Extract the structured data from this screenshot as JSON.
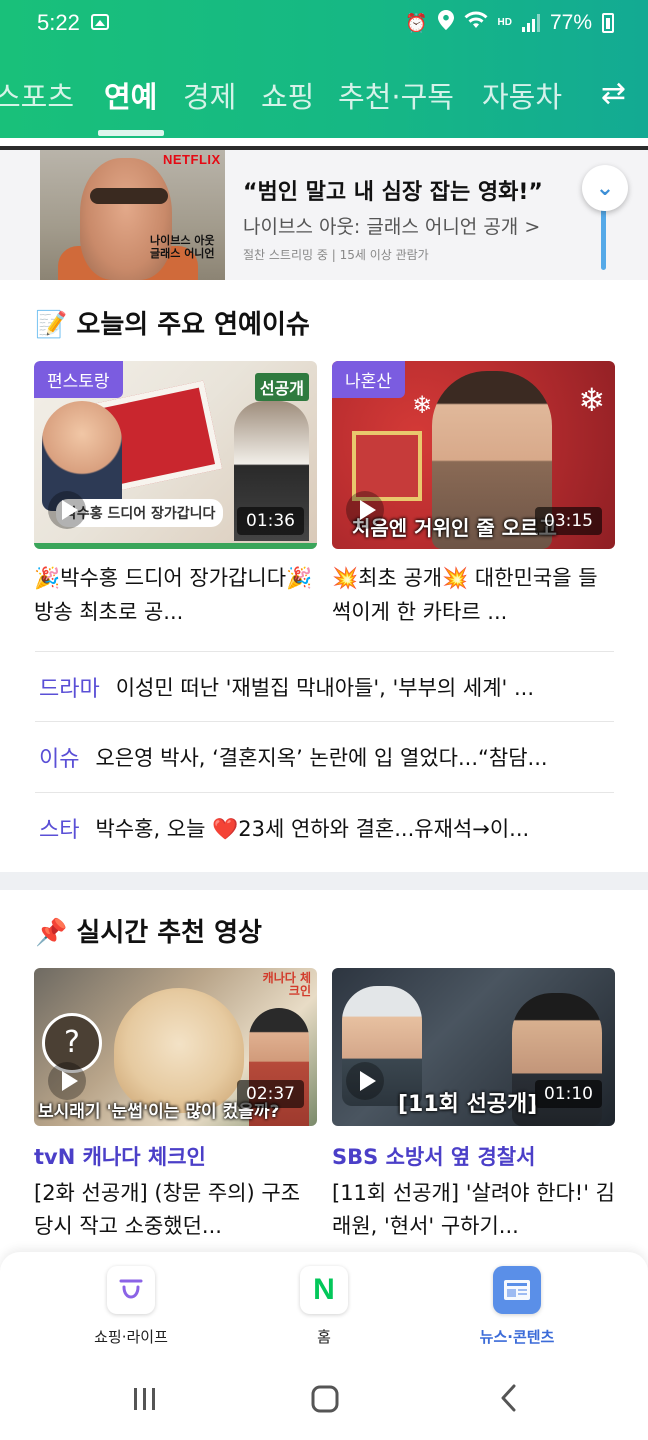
{
  "status_bar": {
    "time": "5:22",
    "battery": "77%",
    "hd_label": "HD"
  },
  "tabs": [
    {
      "label": "스포츠",
      "active": false
    },
    {
      "label": "연예",
      "active": true
    },
    {
      "label": "경제",
      "active": false
    },
    {
      "label": "쇼핑",
      "active": false
    },
    {
      "label": "추천·구독",
      "active": false
    },
    {
      "label": "자동차",
      "active": false
    }
  ],
  "banner": {
    "brand": "NETFLIX",
    "poster_title": "나이브스 아웃\n글래스 어니언",
    "headline": "“범인 말고 내 심장 잡는 영화!”",
    "subtitle": "나이브스 아웃: 글래스 어니언 공개 >",
    "meta": "절찬 스트리밍 중 | 15세 이상 관람가"
  },
  "issues_section": {
    "title": "📝 오늘의 주요 연예이슈",
    "cards": [
      {
        "badge": "편스토랑",
        "duration": "01:36",
        "title": "🎉박수홍 드디어 장가갑니다🎉 방송 최초로 공...",
        "thumb_caption": "박수홍 드디어 장가갑니다",
        "thumb_tag": "선공개"
      },
      {
        "badge": "나혼산",
        "duration": "03:15",
        "title": "💥최초 공개💥 대한민국을 들썩이게 한 카타르 ...",
        "thumb_caption": "처음엔 거위인 줄 오르고"
      }
    ],
    "rows": [
      {
        "category": "드라마",
        "text": "이성민 떠난 '재벌집 막내아들', '부부의 세계' ..."
      },
      {
        "category": "이슈",
        "text": "오은영 박사, ‘결혼지옥’ 논란에 입 열었다...“참담..."
      },
      {
        "category": "스타",
        "text": "박수홍, 오늘 ❤️23세 연하와 결혼...유재석→이..."
      }
    ]
  },
  "videos_section": {
    "title": "📌 실시간 추천 영상",
    "cards": [
      {
        "duration": "02:37",
        "channel": "tvN 캐나다 체크인",
        "description": "[2화 선공개] (창문 주의) 구조 당시 작고 소중했던...",
        "thumb_caption": "보시래기 '눈썹'이는 많이 컸을까?",
        "thumb_tag": "캐나다 체크인"
      },
      {
        "duration": "01:10",
        "channel": "SBS 소방서 옆 경찰서",
        "description": "[11회 선공개] '살려야 한다!' 김래원, '현서' 구하기...",
        "thumb_caption": "[11회 선공개]"
      }
    ]
  },
  "bottom_nav": [
    {
      "label": "쇼핑·라이프",
      "icon": "shopping-icon",
      "active": false
    },
    {
      "label": "홈",
      "icon": "naver-n-icon",
      "active": false,
      "glyph": "N"
    },
    {
      "label": "뉴스·콘텐츠",
      "icon": "news-icon",
      "active": true
    }
  ],
  "colors": {
    "header": "#17b886",
    "accent_purple": "#5a4fd6",
    "badge_purple": "#7b5ce0",
    "active_nav": "#3b6bd8",
    "naver_green": "#03c75a"
  }
}
